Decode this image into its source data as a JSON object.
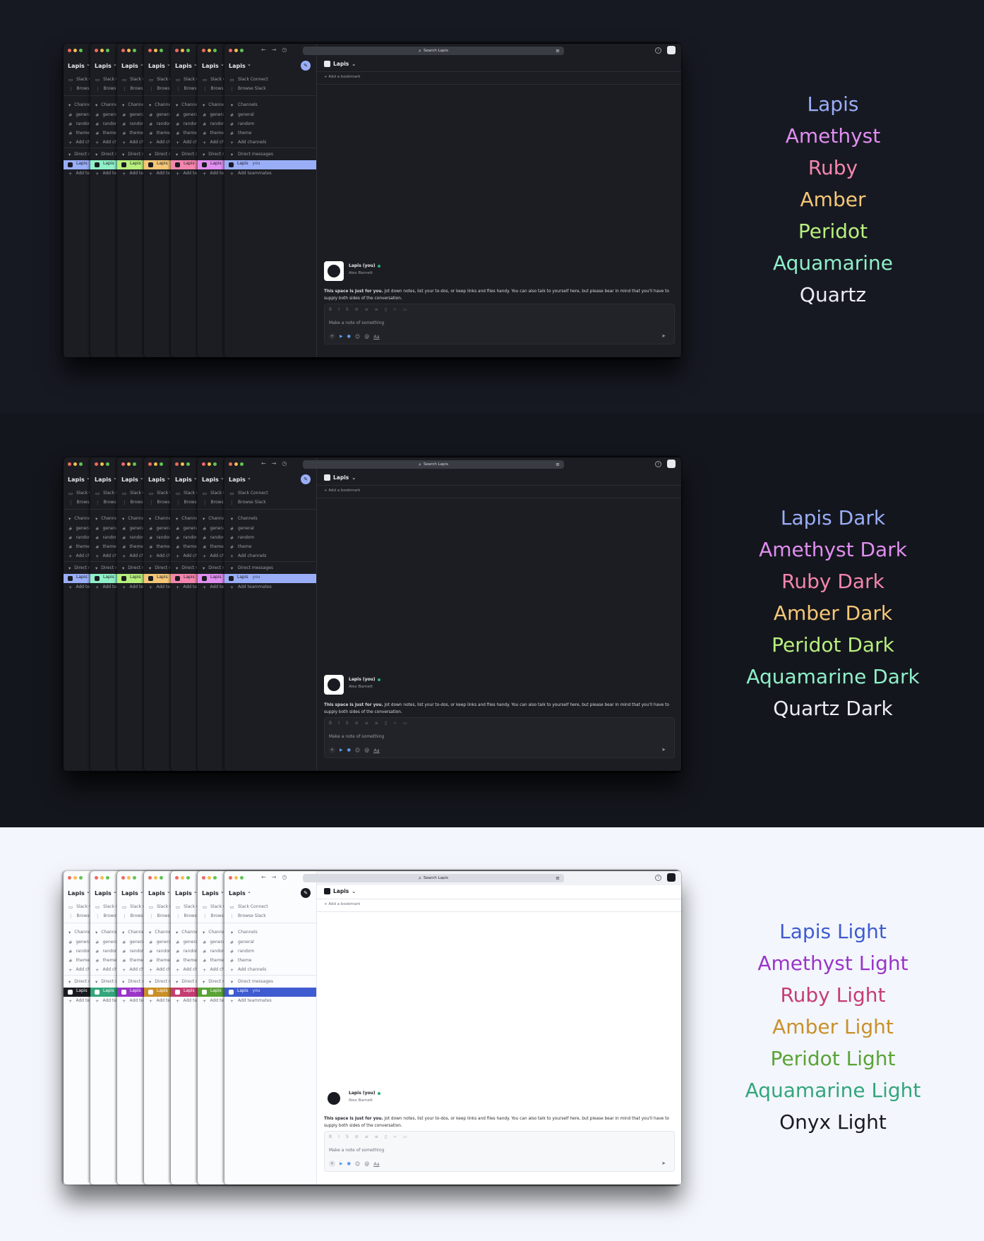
{
  "app": {
    "workspace": "Lapis",
    "sidebar_top": [
      "Slack Connect",
      "Browse Slack"
    ],
    "channels_header": "Channels",
    "channels": [
      "general",
      "random",
      "theme"
    ],
    "add_channels": "Add channels",
    "dm_header": "Direct messages",
    "dm_self": "Lapis",
    "dm_self_tag": "you",
    "add_teammates": "Add teammates",
    "search_placeholder": "Search Lapis",
    "channel_title": "Lapis",
    "add_bookmark": "Add a bookmark",
    "profile_name": "Lapis (you)",
    "profile_sub": "Alex Barnett",
    "intro_bold": "This space is just for you.",
    "intro_text": " Jot down notes, list your to-dos, or keep links and files handy. You can also talk to yourself here, but please bear in mind that you'll have to supply both sides of the conversation.",
    "composer_placeholder": "Make a note of something",
    "composer_aa": "Aa"
  },
  "sections": [
    {
      "name": "default",
      "themes": [
        {
          "label": "Lapis",
          "color": "#9aaef8"
        },
        {
          "label": "Amethyst",
          "color": "#e08ef0"
        },
        {
          "label": "Ruby",
          "color": "#f486ad"
        },
        {
          "label": "Amber",
          "color": "#f5c777"
        },
        {
          "label": "Peridot",
          "color": "#b8f07d"
        },
        {
          "label": "Aquamarine",
          "color": "#8ff0c8"
        },
        {
          "label": "Quartz",
          "color": "#ececf3"
        }
      ]
    },
    {
      "name": "dark",
      "themes": [
        {
          "label": "Lapis Dark",
          "color": "#9aaef8"
        },
        {
          "label": "Amethyst Dark",
          "color": "#e08ef0"
        },
        {
          "label": "Ruby Dark",
          "color": "#f486ad"
        },
        {
          "label": "Amber Dark",
          "color": "#f5c777"
        },
        {
          "label": "Peridot Dark",
          "color": "#b8f07d"
        },
        {
          "label": "Aquamarine Dark",
          "color": "#8ff0c8"
        },
        {
          "label": "Quartz Dark",
          "color": "#ececf3"
        }
      ]
    },
    {
      "name": "light",
      "themes": [
        {
          "label": "Lapis Light",
          "color": "#3f5bd0"
        },
        {
          "label": "Amethyst Light",
          "color": "#9a35c8"
        },
        {
          "label": "Ruby Light",
          "color": "#c53d73"
        },
        {
          "label": "Amber Light",
          "color": "#c9902a"
        },
        {
          "label": "Peridot Light",
          "color": "#5aa335"
        },
        {
          "label": "Aquamarine Light",
          "color": "#33a67b"
        },
        {
          "label": "Onyx Light",
          "color": "#1a1b22"
        }
      ]
    }
  ]
}
